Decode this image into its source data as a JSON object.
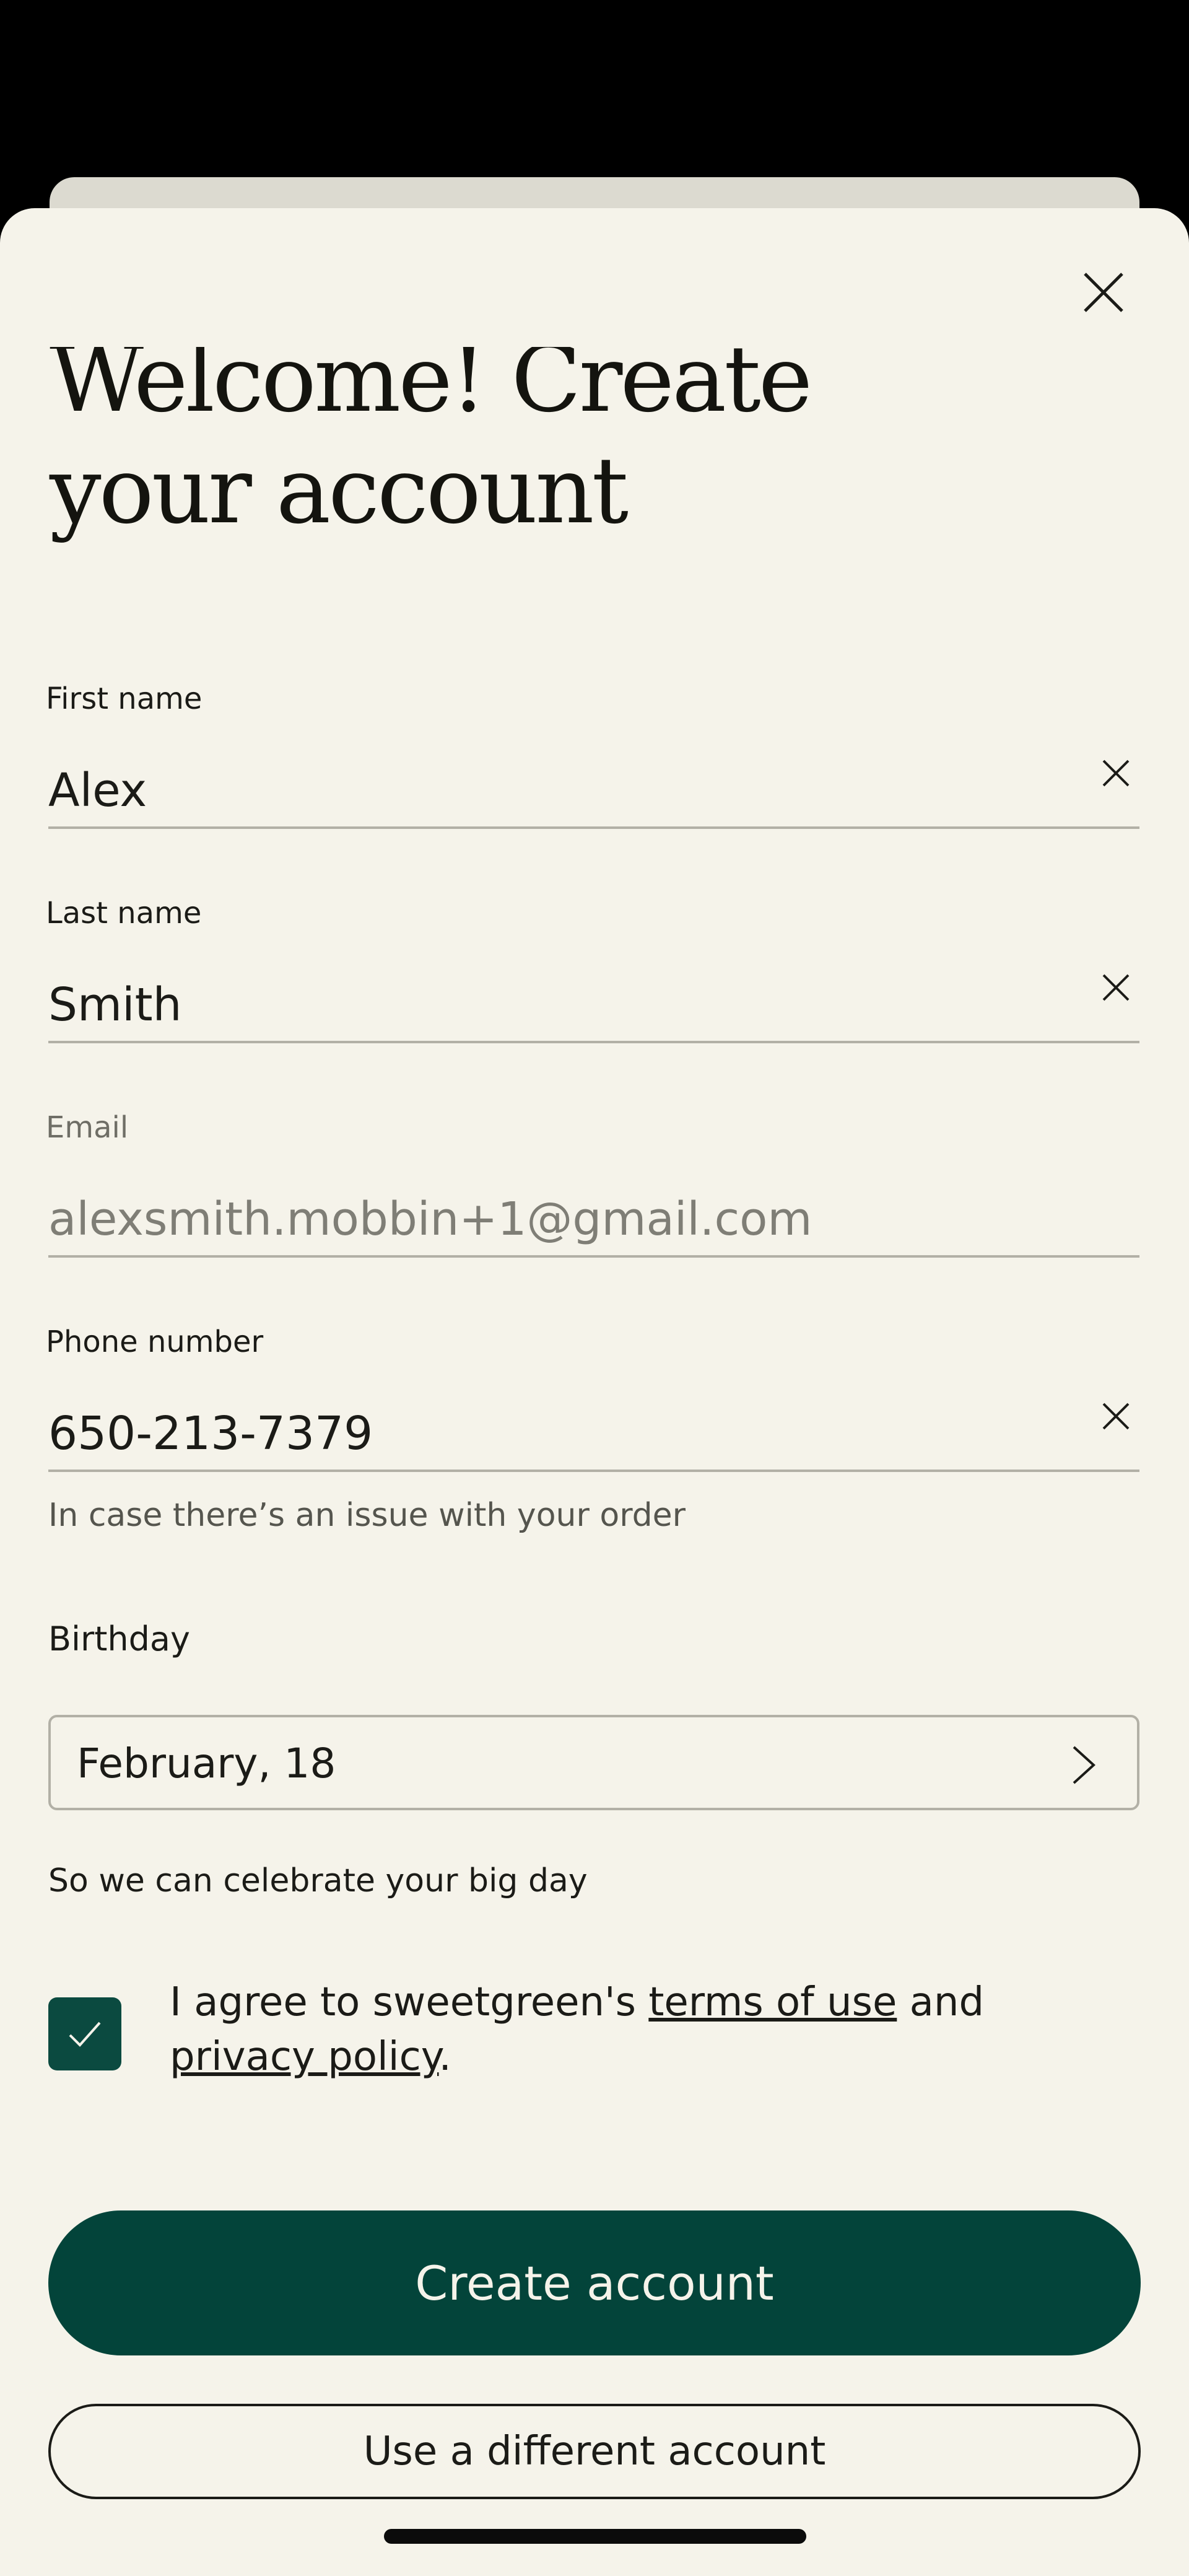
{
  "sheet": {
    "title": "Welcome! Create your account"
  },
  "form": {
    "first_name": {
      "label": "First name",
      "value": "Alex"
    },
    "last_name": {
      "label": "Last name",
      "value": "Smith"
    },
    "email": {
      "label": "Email",
      "value": "alexsmith.mobbin+1@gmail.com"
    },
    "phone": {
      "label": "Phone number",
      "value": "650-213-7379",
      "helper": "In case there’s an issue with your order"
    },
    "birthday": {
      "label": "Birthday",
      "value": "February, 18",
      "helper": "So we can celebrate your big day"
    }
  },
  "agreement": {
    "checked": true,
    "prefix": "I agree to sweetgreen's ",
    "terms_link": "terms of use",
    "middle": " and ",
    "privacy_link": "privacy policy",
    "suffix": "."
  },
  "actions": {
    "create_label": "Create account",
    "different_label": "Use a different account"
  },
  "colors": {
    "background": "#f5f3ea",
    "primary": "#03443a",
    "text": "#1b1b17"
  }
}
